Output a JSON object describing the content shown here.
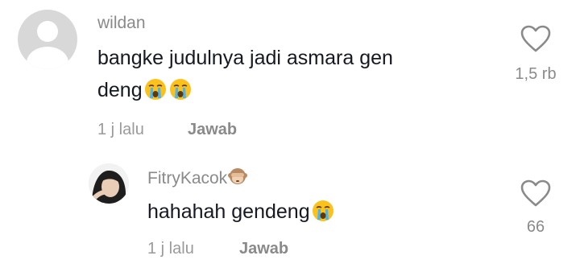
{
  "comment": {
    "username": "wildan",
    "text_line1": "bangke judulnya jadi asmara gen",
    "text_line2": "deng",
    "time": "1 j lalu",
    "reply_label": "Jawab",
    "like_count": "1,5 rb",
    "emojis": [
      "crying-face",
      "crying-face"
    ]
  },
  "reply": {
    "username": "FitryKacok",
    "username_emoji": "see-no-evil-monkey",
    "text": "hahahah gendeng",
    "time": "1 j lalu",
    "reply_label": "Jawab",
    "like_count": "66",
    "emojis": [
      "crying-face"
    ]
  },
  "icons": {
    "like": "heart-outline-icon"
  },
  "colors": {
    "text_primary": "#161823",
    "text_secondary": "#8a8a8a",
    "avatar_placeholder": "#d8d8d8"
  }
}
